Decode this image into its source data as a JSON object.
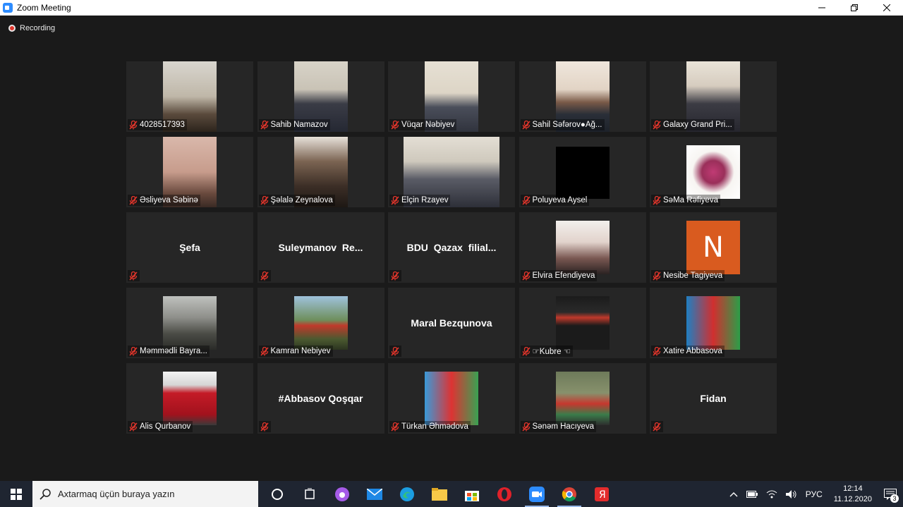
{
  "window": {
    "title": "Zoom Meeting",
    "controls": [
      "minimize-icon",
      "restore-icon",
      "close-icon"
    ]
  },
  "recording": {
    "label": "Recording"
  },
  "participants": [
    {
      "name": "4028517393",
      "display": "video",
      "muted": true
    },
    {
      "name": "Sahib Namazov",
      "display": "video",
      "muted": true
    },
    {
      "name": "Vüqar Nəbiyev",
      "display": "video",
      "muted": true
    },
    {
      "name": "Sahil Səfərov●Ağ...",
      "display": "video",
      "muted": true
    },
    {
      "name": "Galaxy Grand Pri...",
      "display": "video",
      "muted": true
    },
    {
      "name": "Əsliyeva Səbinə",
      "display": "video",
      "muted": true
    },
    {
      "name": "Şəlalə Zeynalova",
      "display": "video",
      "muted": true
    },
    {
      "name": "Elçin Rzayev",
      "display": "video",
      "muted": true
    },
    {
      "name": "Poluyeva Aysel",
      "display": "video",
      "muted": true
    },
    {
      "name": "SəMa Rəfiyeva",
      "display": "video",
      "muted": true
    },
    {
      "name": "Şefa",
      "display": "name",
      "muted": true
    },
    {
      "name": "Suleymanov  Re...",
      "display": "name",
      "muted": true
    },
    {
      "name": "BDU  Qazax  filial...",
      "display": "name",
      "muted": true
    },
    {
      "name": "Elvira Efendiyeva",
      "display": "video",
      "muted": true
    },
    {
      "name": "Nesibe Tagiyeva",
      "display": "avatar",
      "avatar_letter": "N",
      "muted": true
    },
    {
      "name": "Məmmədli Bayra...",
      "display": "video",
      "muted": true
    },
    {
      "name": "Kamran Nebiyev",
      "display": "video",
      "muted": true
    },
    {
      "name": "Maral Bezqunova",
      "display": "name",
      "muted": true
    },
    {
      "name": "☞Kubre ☜",
      "display": "video",
      "muted": true
    },
    {
      "name": "Xatire Abbasova",
      "display": "video",
      "muted": true
    },
    {
      "name": "Alis Qurbanov",
      "display": "video",
      "muted": true
    },
    {
      "name": "#Abbasov Qoşqar",
      "display": "name",
      "muted": true
    },
    {
      "name": "Türkan Əhmədova",
      "display": "video",
      "muted": true
    },
    {
      "name": "Sənəm Hacıyeva",
      "display": "video",
      "muted": true
    },
    {
      "name": "Fidan",
      "display": "name",
      "muted": true
    }
  ],
  "taskbar": {
    "search_placeholder": "Axtarmaq üçün buraya yazın",
    "apps": [
      "cortana-icon",
      "task-view-icon",
      "assistant-icon",
      "mail-icon",
      "edge-icon",
      "file-explorer-icon",
      "store-icon",
      "opera-icon",
      "zoom-icon",
      "chrome-icon",
      "yandex-icon"
    ],
    "language": "РУС",
    "time": "12:14",
    "date": "11.12.2020",
    "notification_count": "3"
  },
  "colors": {
    "background": "#1a1a1a",
    "tile": "#262626",
    "muted_mic": "#e0352b",
    "taskbar": "#1f2531"
  }
}
